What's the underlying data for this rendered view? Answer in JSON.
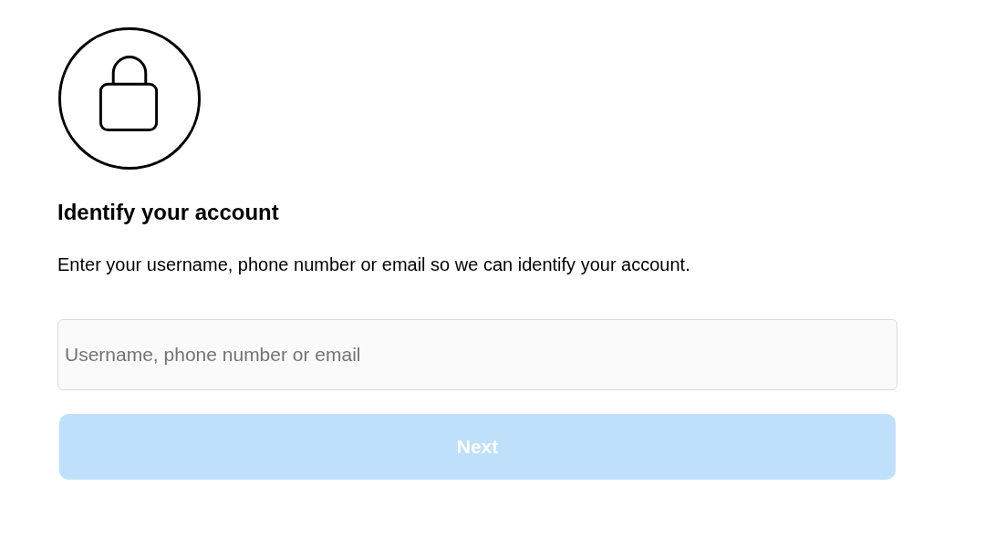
{
  "heading": "Identify your account",
  "description": "Enter your username, phone number or email so we can identify your account.",
  "field": {
    "placeholder": "Username, phone number or email"
  },
  "next_button": {
    "label": "Next",
    "disabled": true
  }
}
